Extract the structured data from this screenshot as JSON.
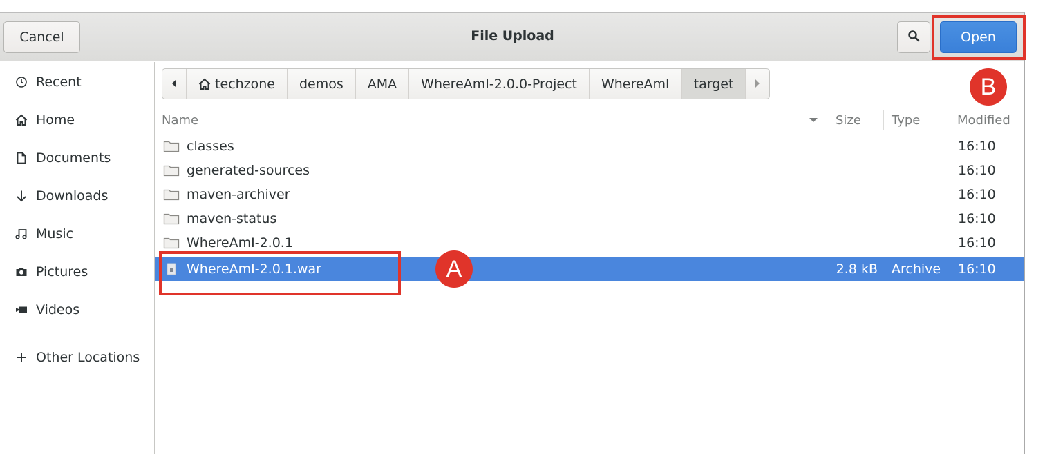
{
  "header": {
    "title": "File Upload",
    "cancel_label": "Cancel",
    "open_label": "Open",
    "search_icon": "search-icon"
  },
  "sidebar": {
    "items": [
      {
        "label": "Recent",
        "icon": "clock-icon"
      },
      {
        "label": "Home",
        "icon": "home-icon"
      },
      {
        "label": "Documents",
        "icon": "document-icon"
      },
      {
        "label": "Downloads",
        "icon": "download-icon"
      },
      {
        "label": "Music",
        "icon": "music-icon"
      },
      {
        "label": "Pictures",
        "icon": "camera-icon"
      },
      {
        "label": "Videos",
        "icon": "video-icon"
      }
    ],
    "other_locations": {
      "label": "Other Locations",
      "icon": "plus-icon"
    }
  },
  "pathbar": {
    "crumbs": [
      "techzone",
      "demos",
      "AMA",
      "WhereAmI-2.0.0-Project",
      "WhereAmI",
      "target"
    ],
    "active": "target"
  },
  "columns": {
    "name": "Name",
    "size": "Size",
    "type": "Type",
    "modified": "Modified"
  },
  "files": [
    {
      "name": "classes",
      "size": "",
      "type": "",
      "modified": "16:10",
      "kind": "folder"
    },
    {
      "name": "generated-sources",
      "size": "",
      "type": "",
      "modified": "16:10",
      "kind": "folder"
    },
    {
      "name": "maven-archiver",
      "size": "",
      "type": "",
      "modified": "16:10",
      "kind": "folder"
    },
    {
      "name": "maven-status",
      "size": "",
      "type": "",
      "modified": "16:10",
      "kind": "folder"
    },
    {
      "name": "WhereAmI-2.0.1",
      "size": "",
      "type": "",
      "modified": "16:10",
      "kind": "folder"
    },
    {
      "name": "WhereAmI-2.0.1.war",
      "size": "2.8 kB",
      "type": "Archive",
      "modified": "16:10",
      "kind": "archive",
      "selected": true
    }
  ],
  "annotations": {
    "a": "A",
    "b": "B"
  },
  "colors": {
    "accent": "#4a86dd",
    "annotation": "#e0342a"
  }
}
